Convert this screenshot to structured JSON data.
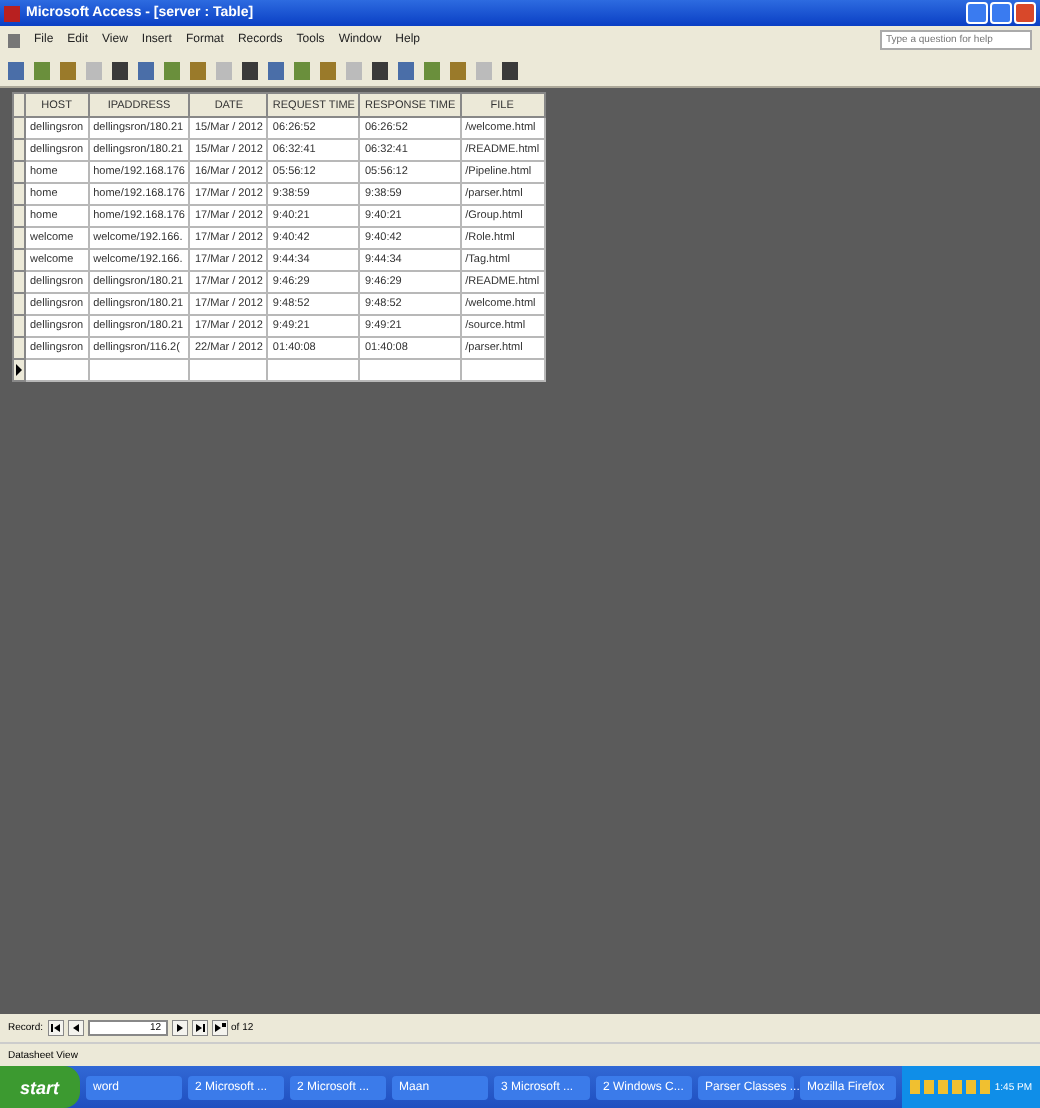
{
  "window": {
    "title": "Microsoft Access - [server : Table]"
  },
  "menu": [
    "File",
    "Edit",
    "View",
    "Insert",
    "Format",
    "Records",
    "Tools",
    "Window",
    "Help"
  ],
  "help_box": {
    "placeholder": "Type a question for help"
  },
  "table": {
    "columns": [
      "HOST",
      "IPADDRESS",
      "DATE",
      "REQUEST TIME",
      "RESPONSE TIME",
      "FILE"
    ],
    "rows": [
      [
        "dellingsron",
        "dellingsron/180.21",
        "15/Mar / 2012",
        "06:26:52",
        "06:26:52",
        "/welcome.html"
      ],
      [
        "dellingsron",
        "dellingsron/180.21",
        "15/Mar / 2012",
        "06:32:41",
        "06:32:41",
        "/README.html"
      ],
      [
        "home",
        "home/192.168.176",
        "16/Mar / 2012",
        "05:56:12",
        "05:56:12",
        "/Pipeline.html"
      ],
      [
        "home",
        "home/192.168.176",
        "17/Mar / 2012",
        "9:38:59",
        "9:38:59",
        "/parser.html"
      ],
      [
        "home",
        "home/192.168.176",
        "17/Mar / 2012",
        "9:40:21",
        "9:40:21",
        "/Group.html"
      ],
      [
        "welcome",
        "welcome/192.166.",
        "17/Mar / 2012",
        "9:40:42",
        "9:40:42",
        "/Role.html"
      ],
      [
        "welcome",
        "welcome/192.166.",
        "17/Mar / 2012",
        "9:44:34",
        "9:44:34",
        "/Tag.html"
      ],
      [
        "dellingsron",
        "dellingsron/180.21",
        "17/Mar / 2012",
        "9:46:29",
        "9:46:29",
        "/README.html"
      ],
      [
        "dellingsron",
        "dellingsron/180.21",
        "17/Mar / 2012",
        "9:48:52",
        "9:48:52",
        "/welcome.html"
      ],
      [
        "dellingsron",
        "dellingsron/180.21",
        "17/Mar / 2012",
        "9:49:21",
        "9:49:21",
        "/source.html"
      ],
      [
        "dellingsron",
        "dellingsron/116.2(",
        "22/Mar / 2012",
        "01:40:08",
        "01:40:08",
        "/parser.html"
      ]
    ]
  },
  "record_nav": {
    "label": "Record:",
    "current": "12",
    "total": "of 12"
  },
  "status_bar": "Datasheet View",
  "taskbar": {
    "start": "start",
    "items": [
      "word",
      "2 Microsoft ...",
      "2 Microsoft ...",
      "Maan",
      "3 Microsoft ...",
      "2 Windows C...",
      "Parser Classes ...",
      "Mozilla Firefox"
    ],
    "clock": "1:45 PM"
  }
}
